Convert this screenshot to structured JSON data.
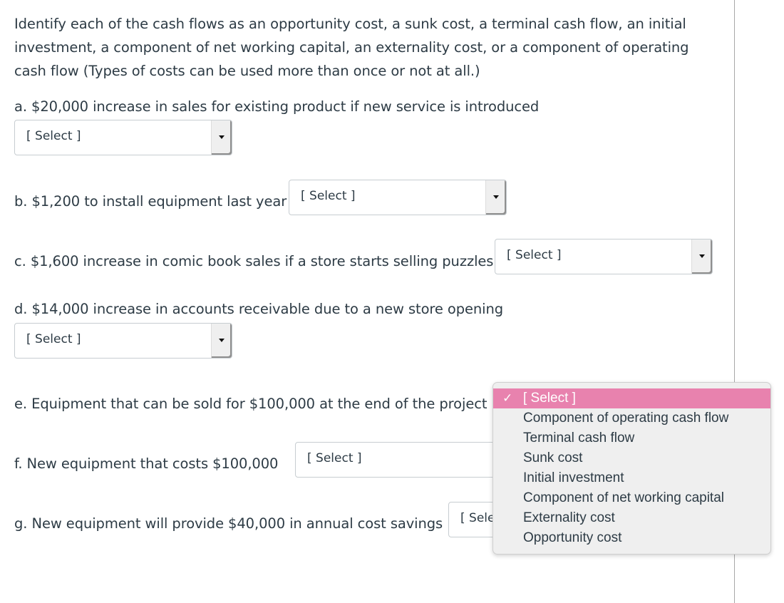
{
  "instructions": "Identify each of the cash flows as an opportunity cost, a sunk cost, a terminal cash flow, an initial investment, a component of net working capital, an externality cost, or a component of operating cash flow (Types of costs can be used more than once or not at all.)",
  "questions": [
    {
      "id": "a",
      "text": "a. $20,000 increase in sales for existing product if new service is introduced",
      "value": "[ Select ]"
    },
    {
      "id": "b",
      "text": "b. $1,200 to install equipment last year",
      "value": "[ Select ]"
    },
    {
      "id": "c",
      "text": "c. $1,600 increase in comic book sales if a store starts selling puzzles",
      "value": "[ Select ]"
    },
    {
      "id": "d",
      "text": "d. $14,000 increase in accounts receivable due to a new store opening",
      "value": "[ Select ]"
    },
    {
      "id": "e",
      "text": "e. Equipment that can be sold for $100,000 at the end of the project",
      "value": "[ Select ]"
    },
    {
      "id": "f",
      "text": "f. New equipment that costs $100,000",
      "value": "[ Select ]"
    },
    {
      "id": "g",
      "text": "g. New equipment will provide $40,000 in annual cost savings",
      "value": "[ Select ]"
    }
  ],
  "dropdown_menu": {
    "check_glyph": "✓",
    "highlight_color": "#e882ae",
    "options": [
      {
        "label": "[ Select ]",
        "selected": true
      },
      {
        "label": "Component of operating cash flow",
        "selected": false
      },
      {
        "label": "Terminal cash flow",
        "selected": false
      },
      {
        "label": "Sunk cost",
        "selected": false
      },
      {
        "label": "Initial investment",
        "selected": false
      },
      {
        "label": "Component of net working capital",
        "selected": false
      },
      {
        "label": "Externality cost",
        "selected": false
      },
      {
        "label": "Opportunity cost",
        "selected": false
      }
    ]
  }
}
